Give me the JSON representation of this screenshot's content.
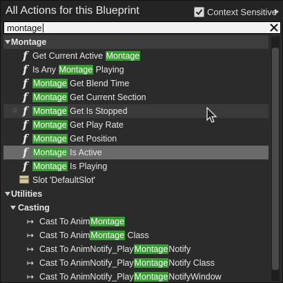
{
  "header": {
    "title": "All Actions for this Blueprint",
    "context_sensitive_label": "Context Sensitive",
    "context_sensitive_checked": true
  },
  "search": {
    "value": "montage"
  },
  "highlight_color": "#33a02c",
  "rows": [
    {
      "kind": "category",
      "label": "Montage"
    },
    {
      "kind": "function",
      "pre": "Get Current Active ",
      "hl": "Montage",
      "post": ""
    },
    {
      "kind": "function",
      "pre": "Is Any ",
      "hl": "Montage",
      "post": " Playing"
    },
    {
      "kind": "function",
      "pre": "",
      "hl": "Montage",
      "post": " Get Blend Time"
    },
    {
      "kind": "function",
      "pre": "",
      "hl": "Montage",
      "post": " Get Current Section"
    },
    {
      "kind": "function",
      "pre": "",
      "hl": "Montage",
      "post": " Get Is Stopped",
      "state": "hover",
      "star": true
    },
    {
      "kind": "function",
      "pre": "",
      "hl": "Montage",
      "post": " Get Play Rate"
    },
    {
      "kind": "function",
      "pre": "",
      "hl": "Montage",
      "post": " Get Position"
    },
    {
      "kind": "function",
      "pre": "",
      "hl": "Montage",
      "post": " Is Active",
      "state": "selected"
    },
    {
      "kind": "function",
      "pre": "",
      "hl": "Montage",
      "post": " Is Playing"
    },
    {
      "kind": "slot",
      "label": "Slot 'DefaultSlot'"
    },
    {
      "kind": "category",
      "label": "Utilities",
      "subtle": true
    },
    {
      "kind": "subcategory",
      "label": "Casting"
    },
    {
      "kind": "cast",
      "pre": "Cast To Anim",
      "hl": "Montage",
      "post": ""
    },
    {
      "kind": "cast",
      "pre": "Cast To Anim",
      "hl": "Montage",
      "post": " Class"
    },
    {
      "kind": "cast",
      "pre": "Cast To AnimNotify_Play",
      "hl": "Montage",
      "post": "Notify"
    },
    {
      "kind": "cast",
      "pre": "Cast To AnimNotify_Play",
      "hl": "Montage",
      "post": "Notify Class"
    },
    {
      "kind": "cast",
      "pre": "Cast To AnimNotify_Play",
      "hl": "Montage",
      "post": "NotifyWindow"
    }
  ],
  "icons": {
    "function": "function-f-icon",
    "cast": "cast-arrow-icon",
    "slot": "slot-node-icon",
    "clear": "close-x-icon",
    "expand": "chevron-down-icon",
    "favorite": "star-icon"
  }
}
